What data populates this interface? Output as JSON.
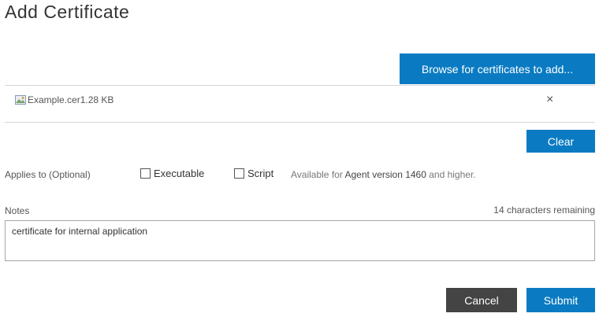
{
  "dialog": {
    "title": "Add Certificate"
  },
  "browse": {
    "label": "Browse for certificates to add..."
  },
  "file": {
    "icon": "file-image-icon",
    "name": "Example.cer",
    "size": "1.28 KB",
    "remove_label": "×"
  },
  "clear": {
    "label": "Clear"
  },
  "applies_to": {
    "label": "Applies to (Optional)",
    "options": [
      {
        "label": "Executable",
        "checked": false
      },
      {
        "label": "Script",
        "checked": false
      }
    ],
    "availability_prefix": "Available for ",
    "availability_strong": "Agent version 1460",
    "availability_suffix": " and higher."
  },
  "notes": {
    "label": "Notes",
    "remaining": "14 characters remaining",
    "value": "certificate for internal application"
  },
  "actions": {
    "cancel_label": "Cancel",
    "submit_label": "Submit"
  },
  "colors": {
    "primary": "#0a7bc2",
    "secondary": "#444444"
  }
}
